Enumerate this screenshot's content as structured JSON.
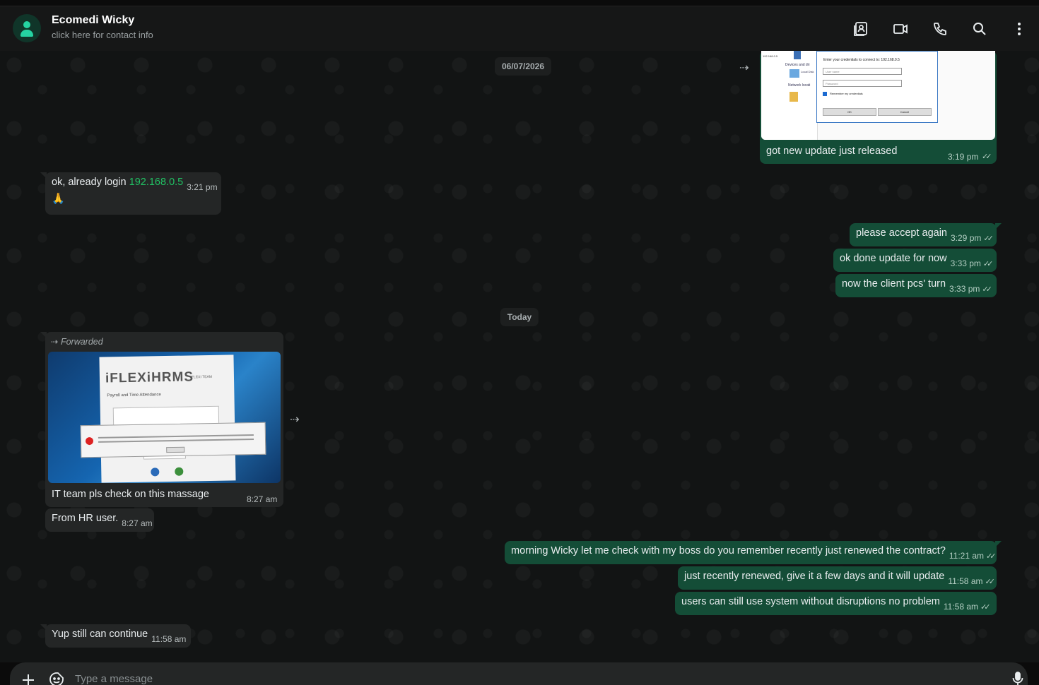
{
  "header": {
    "contact_name": "Ecomedi Wicky",
    "contact_subtitle": "click here for contact info",
    "icons": [
      "contact-card-icon",
      "video-call-icon",
      "voice-call-icon",
      "search-icon",
      "menu-icon"
    ]
  },
  "dates": {
    "first": "06/07/2026",
    "second": "Today"
  },
  "messages": {
    "m1": {
      "text": "got new update just released",
      "time": "3:19 pm",
      "ticks": "✓✓"
    },
    "m2": {
      "text": "ok, already login ",
      "link": "192.168.0.5",
      "time": "3:21 pm",
      "emoji": "🙏"
    },
    "m3": {
      "text": "please accept again",
      "time": "3:29 pm",
      "ticks": "✓✓"
    },
    "m4": {
      "text": "ok done update for now",
      "time": "3:33 pm",
      "ticks": "✓✓"
    },
    "m5": {
      "text": "now the client pcs' turn",
      "time": "3:33 pm",
      "ticks": "✓✓"
    },
    "m6": {
      "forwarded_label": "Forwarded",
      "text": "IT team pls check on this massage",
      "time": "8:27 am"
    },
    "m7": {
      "text": "From HR user.",
      "time": "8:27 am"
    },
    "m8": {
      "text": "morning Wicky let me check with my boss do you remember recently just renewed the contract?",
      "time": "11:21 am",
      "ticks": "✓✓"
    },
    "m9": {
      "text": "just recently renewed, give it a few days and it will update",
      "time": "11:58 am",
      "ticks": "✓✓"
    },
    "m10": {
      "text": "users can still use system without disruptions no problem",
      "time": "11:58 am",
      "ticks": "✓✓"
    },
    "m11": {
      "text": "Yup still can continue",
      "time": "11:58 am"
    }
  },
  "screenshot_out": {
    "ip": "192.168.0.5",
    "prompt": "Enter your credentials to connect to: 192.168.0.5",
    "username_placeholder": "User name",
    "password_placeholder": "Password",
    "remember": "Remember my credentials",
    "ok": "OK",
    "cancel": "Cancel",
    "side_devices": "Devices and dri",
    "side_local": "Local Disk",
    "side_network": "Network locati"
  },
  "screenshot_in": {
    "brand": "iFLEXiHRMS",
    "tagline": "Payroll and Time Attendance",
    "team": "FLEXI TEAM"
  },
  "composer": {
    "placeholder": "Type a message"
  },
  "colors": {
    "header_bg": "#161717",
    "incoming_bg": "#242626",
    "outgoing_bg": "#144d37",
    "link": "#21c063",
    "avatar_fg": "#25d3a2"
  }
}
